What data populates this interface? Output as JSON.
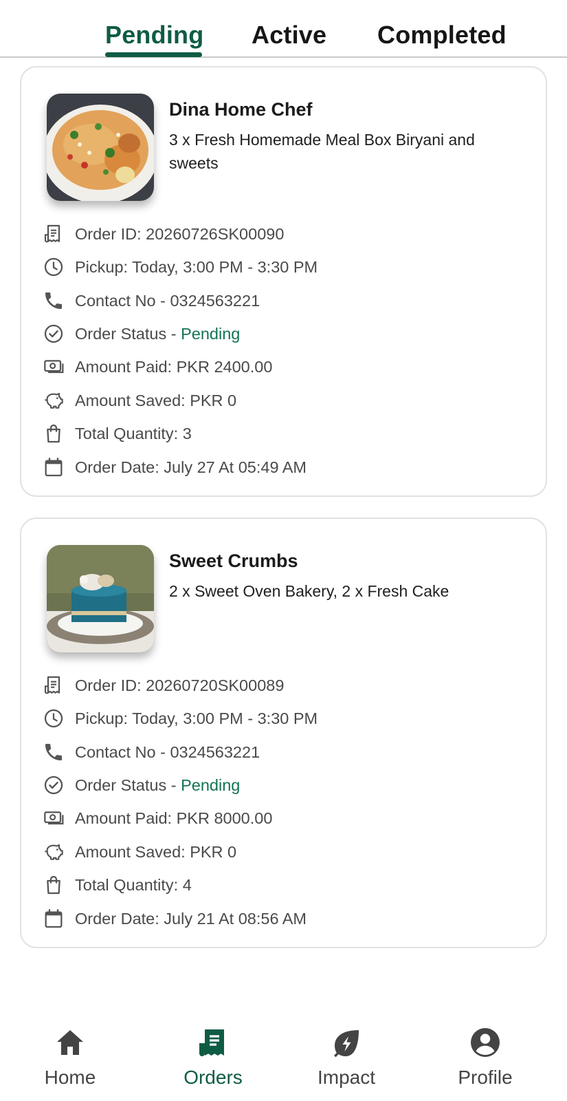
{
  "tabs": [
    {
      "label": "Pending",
      "active": true
    },
    {
      "label": "Active",
      "active": false
    },
    {
      "label": "Completed",
      "active": false
    }
  ],
  "colors": {
    "accent": "#0f5c45",
    "status_pending": "#137452",
    "text_muted": "#4a4a4a"
  },
  "orders": [
    {
      "vendor": "Dina Home Chef",
      "items": "3 x Fresh Homemade Meal Box Biryani and sweets",
      "thumbnail": "biryani-photo",
      "order_id": "Order ID: 20260726SK00090",
      "pickup": "Pickup: Today, 3:00 PM - 3:30 PM",
      "contact": "Contact No - 0324563221",
      "status_label": "Order Status - ",
      "status_value": "Pending",
      "amount_paid": "Amount Paid: PKR 2400.00",
      "amount_saved": "Amount Saved: PKR 0",
      "total_quantity": "Total Quantity: 3",
      "order_date": "Order Date: July 27 At 05:49 AM"
    },
    {
      "vendor": "Sweet Crumbs",
      "items": "2 x Sweet Oven Bakery, 2 x Fresh Cake",
      "thumbnail": "cake-photo",
      "order_id": "Order ID: 20260720SK00089",
      "pickup": "Pickup: Today, 3:00 PM - 3:30 PM",
      "contact": "Contact No - 0324563221",
      "status_label": "Order Status - ",
      "status_value": "Pending",
      "amount_paid": "Amount Paid: PKR 8000.00",
      "amount_saved": "Amount Saved: PKR 0",
      "total_quantity": "Total Quantity: 4",
      "order_date": "Order Date: July 21 At 08:56 AM"
    }
  ],
  "icons": [
    "receipt-icon",
    "clock-icon",
    "phone-icon",
    "check-circle-icon",
    "cash-icon",
    "piggy-bank-icon",
    "shopping-bag-icon",
    "calendar-icon"
  ],
  "nav": [
    {
      "label": "Home",
      "icon": "home-icon",
      "active": false
    },
    {
      "label": "Orders",
      "icon": "orders-receipt-icon",
      "active": true
    },
    {
      "label": "Impact",
      "icon": "impact-leaf-icon",
      "active": false
    },
    {
      "label": "Profile",
      "icon": "profile-icon",
      "active": false
    }
  ]
}
